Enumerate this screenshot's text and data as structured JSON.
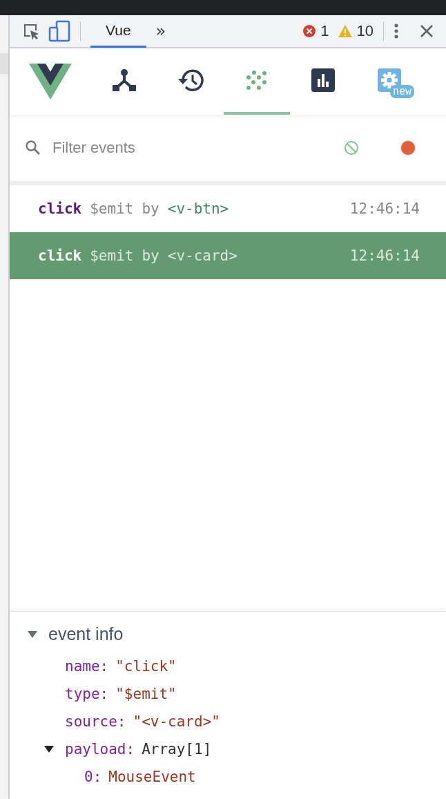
{
  "devtools_toolbar": {
    "tabs": [
      {
        "label": "Vue",
        "selected": true
      }
    ],
    "more": "»",
    "errors": "1",
    "warnings": "10"
  },
  "vue_nav": {
    "tabs": [
      {
        "kind": "components",
        "selected": false
      },
      {
        "kind": "vuex",
        "selected": false
      },
      {
        "kind": "events",
        "selected": true
      },
      {
        "kind": "performance",
        "selected": false
      },
      {
        "kind": "settings",
        "selected": false,
        "badge": "new"
      }
    ]
  },
  "filter": {
    "placeholder": "Filter events",
    "recording": true
  },
  "events": [
    {
      "name": "click",
      "type": "$emit",
      "by": "by",
      "source": "<v-btn>",
      "time": "12:46:14",
      "selected": false
    },
    {
      "name": "click",
      "type": "$emit",
      "by": "by",
      "source": "<v-card>",
      "time": "12:46:14",
      "selected": true
    }
  ],
  "event_info": {
    "label": "event info",
    "expanded": true,
    "children": [
      {
        "key": "name:",
        "value": "\"click\"",
        "kind": "string"
      },
      {
        "key": "type:",
        "value": "\"$emit\"",
        "kind": "string"
      },
      {
        "key": "source:",
        "value": "\"<v-card>\"",
        "kind": "string"
      },
      {
        "key": "payload:",
        "value": "Array[1]",
        "kind": "object",
        "expanded": true,
        "children": [
          {
            "key": "0:",
            "value": "MouseEvent",
            "kind": "string"
          }
        ]
      }
    ]
  }
}
